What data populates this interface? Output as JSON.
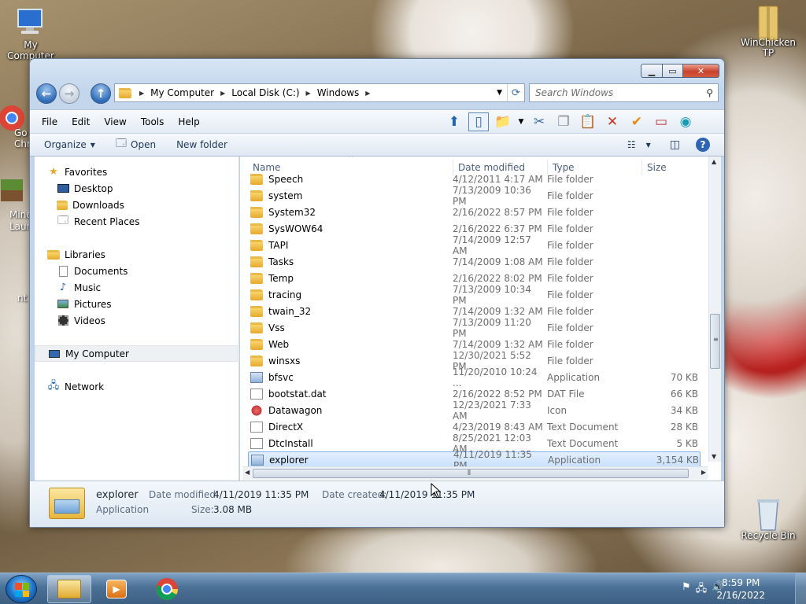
{
  "desktop": {
    "icons": [
      {
        "label": "My Computer",
        "icon": "computer-icon"
      },
      {
        "label": "WinChicken TP",
        "icon": "folder-zip-icon"
      },
      {
        "label": "Recycle Bin",
        "icon": "recycle-bin-icon"
      }
    ],
    "partial_labels": [
      "Go",
      "Chr",
      "Mine",
      "Laun",
      "nt"
    ]
  },
  "window": {
    "nav_back": "back-arrow-icon",
    "nav_forward": "forward-arrow-icon",
    "nav_up": "up-arrow-icon",
    "breadcrumb": [
      "My Computer",
      "Local Disk (C:)",
      "Windows"
    ],
    "search_placeholder": "Search Windows",
    "menu": [
      "File",
      "Edit",
      "View",
      "Tools",
      "Help"
    ],
    "commands": {
      "organize": "Organize",
      "open": "Open",
      "new_folder": "New folder"
    },
    "nav_pane": {
      "favorites": "Favorites",
      "favorites_items": [
        "Desktop",
        "Downloads",
        "Recent Places"
      ],
      "libraries": "Libraries",
      "libraries_items": [
        "Documents",
        "Music",
        "Pictures",
        "Videos"
      ],
      "computer": "My Computer",
      "network": "Network"
    },
    "columns": {
      "name": "Name",
      "date": "Date modified",
      "type": "Type",
      "size": "Size"
    },
    "files": [
      {
        "name": "Speech",
        "date": "4/12/2011 4:17 AM",
        "type": "File folder",
        "size": "",
        "kind": "folder"
      },
      {
        "name": "system",
        "date": "7/13/2009 10:36 PM",
        "type": "File folder",
        "size": "",
        "kind": "folder"
      },
      {
        "name": "System32",
        "date": "2/16/2022 8:57 PM",
        "type": "File folder",
        "size": "",
        "kind": "folder"
      },
      {
        "name": "SysWOW64",
        "date": "2/16/2022 6:37 PM",
        "type": "File folder",
        "size": "",
        "kind": "folder"
      },
      {
        "name": "TAPI",
        "date": "7/14/2009 12:57 AM",
        "type": "File folder",
        "size": "",
        "kind": "folder"
      },
      {
        "name": "Tasks",
        "date": "7/14/2009 1:08 AM",
        "type": "File folder",
        "size": "",
        "kind": "folder"
      },
      {
        "name": "Temp",
        "date": "2/16/2022 8:02 PM",
        "type": "File folder",
        "size": "",
        "kind": "folder"
      },
      {
        "name": "tracing",
        "date": "7/13/2009 10:34 PM",
        "type": "File folder",
        "size": "",
        "kind": "folder"
      },
      {
        "name": "twain_32",
        "date": "7/14/2009 1:32 AM",
        "type": "File folder",
        "size": "",
        "kind": "folder"
      },
      {
        "name": "Vss",
        "date": "7/13/2009 11:20 PM",
        "type": "File folder",
        "size": "",
        "kind": "folder"
      },
      {
        "name": "Web",
        "date": "7/14/2009 1:32 AM",
        "type": "File folder",
        "size": "",
        "kind": "folder"
      },
      {
        "name": "winsxs",
        "date": "12/30/2021 5:52 PM",
        "type": "File folder",
        "size": "",
        "kind": "folder"
      },
      {
        "name": "bfsvc",
        "date": "11/20/2010 10:24 ...",
        "type": "Application",
        "size": "70 KB",
        "kind": "app"
      },
      {
        "name": "bootstat.dat",
        "date": "2/16/2022 8:52 PM",
        "type": "DAT File",
        "size": "66 KB",
        "kind": "doc"
      },
      {
        "name": "Datawagon",
        "date": "12/23/2021 7:33 AM",
        "type": "Icon",
        "size": "34 KB",
        "kind": "ico"
      },
      {
        "name": "DirectX",
        "date": "4/23/2019 8:43 AM",
        "type": "Text Document",
        "size": "28 KB",
        "kind": "doc"
      },
      {
        "name": "DtcInstall",
        "date": "8/25/2021 12:03 AM",
        "type": "Text Document",
        "size": "5 KB",
        "kind": "doc"
      },
      {
        "name": "explorer",
        "date": "4/11/2019 11:35 PM",
        "type": "Application",
        "size": "3,154 KB",
        "kind": "app",
        "selected": true
      }
    ],
    "details": {
      "name": "explorer",
      "type": "Application",
      "modified_label": "Date modified:",
      "modified_value": "4/11/2019 11:35 PM",
      "created_label": "Date created:",
      "created_value": "4/11/2019 11:35 PM",
      "size_label": "Size:",
      "size_value": "3.08 MB"
    }
  },
  "taskbar": {
    "time": "8:59 PM",
    "date": "2/16/2022",
    "pinned": [
      "explorer-icon",
      "media-player-icon",
      "chrome-icon"
    ]
  }
}
